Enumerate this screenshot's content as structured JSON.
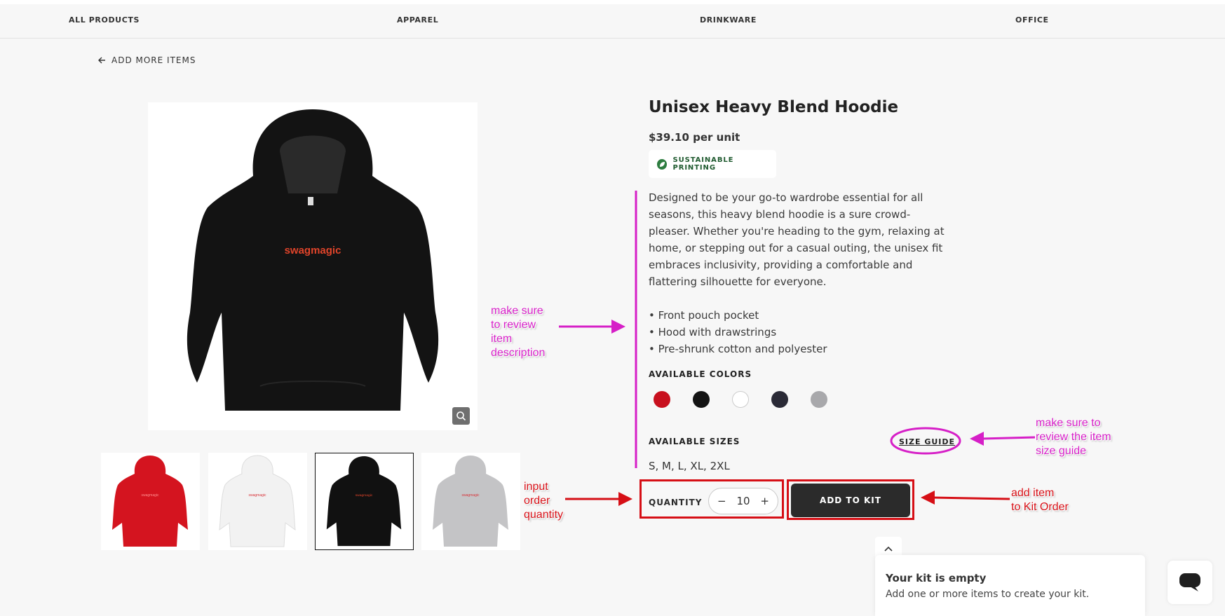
{
  "nav": {
    "items": [
      "ALL PRODUCTS",
      "APPAREL",
      "DRINKWARE",
      "OFFICE"
    ]
  },
  "back_link": "ADD MORE ITEMS",
  "product": {
    "title": "Unisex Heavy Blend Hoodie",
    "price": "$39.10 per unit",
    "badge": "SUSTAINABLE PRINTING",
    "description": "Designed to be your go-to wardrobe essential for all seasons, this heavy blend hoodie is a sure crowd-pleaser. Whether you're heading to the gym, relaxing at home, or stepping out for a casual outing, the unisex fit embraces inclusivity, providing a comfortable and flattering silhouette for everyone.",
    "bullets": [
      "• Front pouch pocket",
      "• Hood with drawstrings",
      "• Pre-shrunk cotton and polyester"
    ],
    "image_logo_text": "swagmagic",
    "colors_label": "AVAILABLE COLORS",
    "colors": [
      "#c8101e",
      "#141414",
      "#ffffff",
      "#2a2a36",
      "#a8a8ab"
    ],
    "sizes_label": "AVAILABLE SIZES",
    "sizes": "S, M, L, XL, 2XL",
    "size_guide": "SIZE GUIDE",
    "quantity_label": "QUANTITY",
    "quantity": "10",
    "minus": "−",
    "plus": "+",
    "add_button": "ADD TO KIT",
    "thumbnails": [
      {
        "color": "#d4141f",
        "logo": "swagmagic"
      },
      {
        "color": "#f4f4f4",
        "logo": "swagmagic"
      },
      {
        "color": "#111111",
        "logo": "swagmagic"
      },
      {
        "color": "#c4c4c6",
        "logo": "swagmagic"
      }
    ],
    "selected_thumbnail": 3
  },
  "kit": {
    "title": "Your kit is empty",
    "subtitle": "Add one or more items to create your kit."
  },
  "annotations": {
    "description": [
      "make sure",
      "to review",
      "item",
      "description"
    ],
    "size_guide": [
      "make sure to",
      "review the item",
      "size guide"
    ],
    "quantity": [
      "input",
      "order",
      "quantity"
    ],
    "add": [
      "add item",
      "to Kit Order"
    ]
  },
  "colors": {
    "annotation_magenta": "#d61fc7",
    "annotation_red": "#d60f16",
    "button_dark": "#2b2b2b",
    "badge_green": "#2e7d40"
  }
}
